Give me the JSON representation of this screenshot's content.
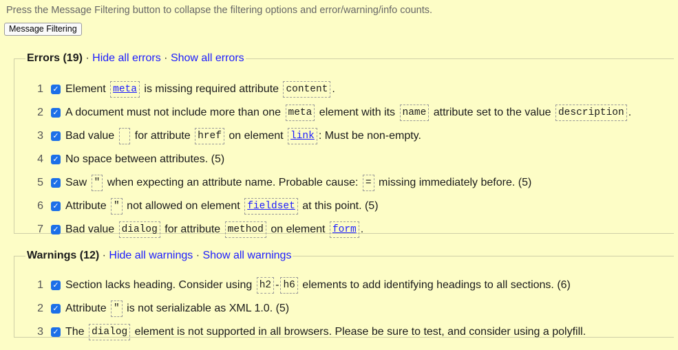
{
  "intro": "Press the Message Filtering button to collapse the filtering options and error/warning/info counts.",
  "filter_button": "Message Filtering",
  "errors": {
    "title": "Errors (19)",
    "sep": " · ",
    "hide": "Hide all errors",
    "show": "Show all errors",
    "items": [
      {
        "num": "1",
        "segs": [
          {
            "t": "Element "
          },
          {
            "c": "meta",
            "link": true
          },
          {
            "t": " is missing required attribute "
          },
          {
            "c": "content"
          },
          {
            "t": "."
          }
        ]
      },
      {
        "num": "2",
        "segs": [
          {
            "t": "A document must not include more than one "
          },
          {
            "c": "meta"
          },
          {
            "t": " element with its "
          },
          {
            "c": "name"
          },
          {
            "t": " attribute set to the value "
          },
          {
            "c": "description"
          },
          {
            "t": "."
          }
        ]
      },
      {
        "num": "3",
        "segs": [
          {
            "t": "Bad value "
          },
          {
            "c": " "
          },
          {
            "t": " for attribute "
          },
          {
            "c": "href"
          },
          {
            "t": " on element "
          },
          {
            "c": "link",
            "link": true
          },
          {
            "t": ": Must be non-empty."
          }
        ]
      },
      {
        "num": "4",
        "segs": [
          {
            "t": "No space between attributes. (5)"
          }
        ]
      },
      {
        "num": "5",
        "segs": [
          {
            "t": "Saw "
          },
          {
            "c": "\""
          },
          {
            "t": " when expecting an attribute name. Probable cause: "
          },
          {
            "c": "="
          },
          {
            "t": " missing immediately before. (5)"
          }
        ]
      },
      {
        "num": "6",
        "segs": [
          {
            "t": "Attribute "
          },
          {
            "c": "\""
          },
          {
            "t": " not allowed on element "
          },
          {
            "c": "fieldset",
            "link": true
          },
          {
            "t": " at this point. (5)"
          }
        ]
      },
      {
        "num": "7",
        "segs": [
          {
            "t": "Bad value "
          },
          {
            "c": "dialog"
          },
          {
            "t": " for attribute "
          },
          {
            "c": "method"
          },
          {
            "t": " on element "
          },
          {
            "c": "form",
            "link": true
          },
          {
            "t": "."
          }
        ]
      }
    ]
  },
  "warnings": {
    "title": "Warnings (12)",
    "sep": " · ",
    "hide": "Hide all warnings",
    "show": "Show all warnings",
    "items": [
      {
        "num": "1",
        "segs": [
          {
            "t": "Section lacks heading. Consider using "
          },
          {
            "c": "h2"
          },
          {
            "t": "-"
          },
          {
            "c": "h6"
          },
          {
            "t": " elements to add identifying headings to all sections. (6)"
          }
        ]
      },
      {
        "num": "2",
        "segs": [
          {
            "t": "Attribute "
          },
          {
            "c": "\""
          },
          {
            "t": " is not serializable as XML 1.0. (5)"
          }
        ]
      },
      {
        "num": "3",
        "segs": [
          {
            "t": "The "
          },
          {
            "c": "dialog"
          },
          {
            "t": " element is not supported in all browsers. Please be sure to test, and consider using a polyfill."
          }
        ]
      }
    ]
  },
  "checkbox_color": "#1c6fe8",
  "link_color": "#1c1cff",
  "background_color": "#fdfdc6"
}
